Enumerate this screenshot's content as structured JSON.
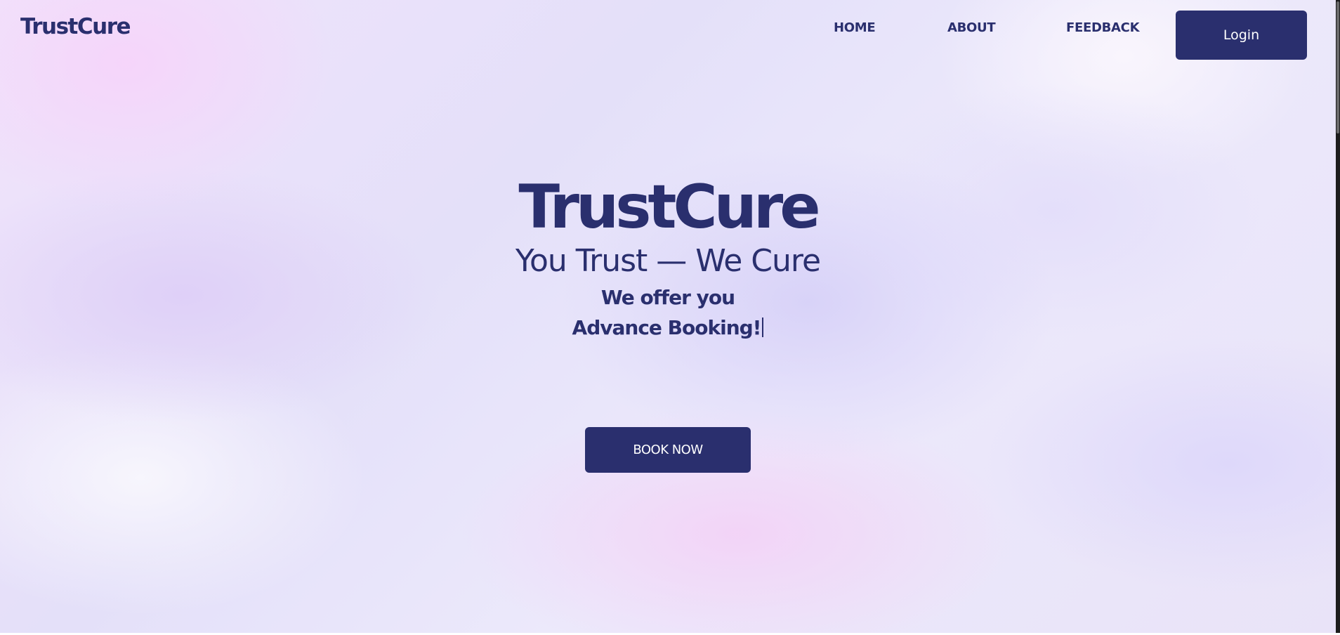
{
  "header": {
    "logo_text": "TrustCure",
    "nav_items": [
      {
        "label": "HOME"
      },
      {
        "label": "ABOUT"
      },
      {
        "label": "FEEDBACK"
      }
    ],
    "login_label": "Login"
  },
  "hero": {
    "title": "TrustCure",
    "tagline": "You Trust — We Cure",
    "subtitle_line1": "We offer you",
    "subtitle_line2": "Advance Booking!",
    "cta_label": "BOOK NOW"
  },
  "colors": {
    "primary": "#2a2f6e",
    "button_text": "#ffffff",
    "background_pink": "#f4d6fa",
    "background_lavender": "#e4e0f9"
  }
}
